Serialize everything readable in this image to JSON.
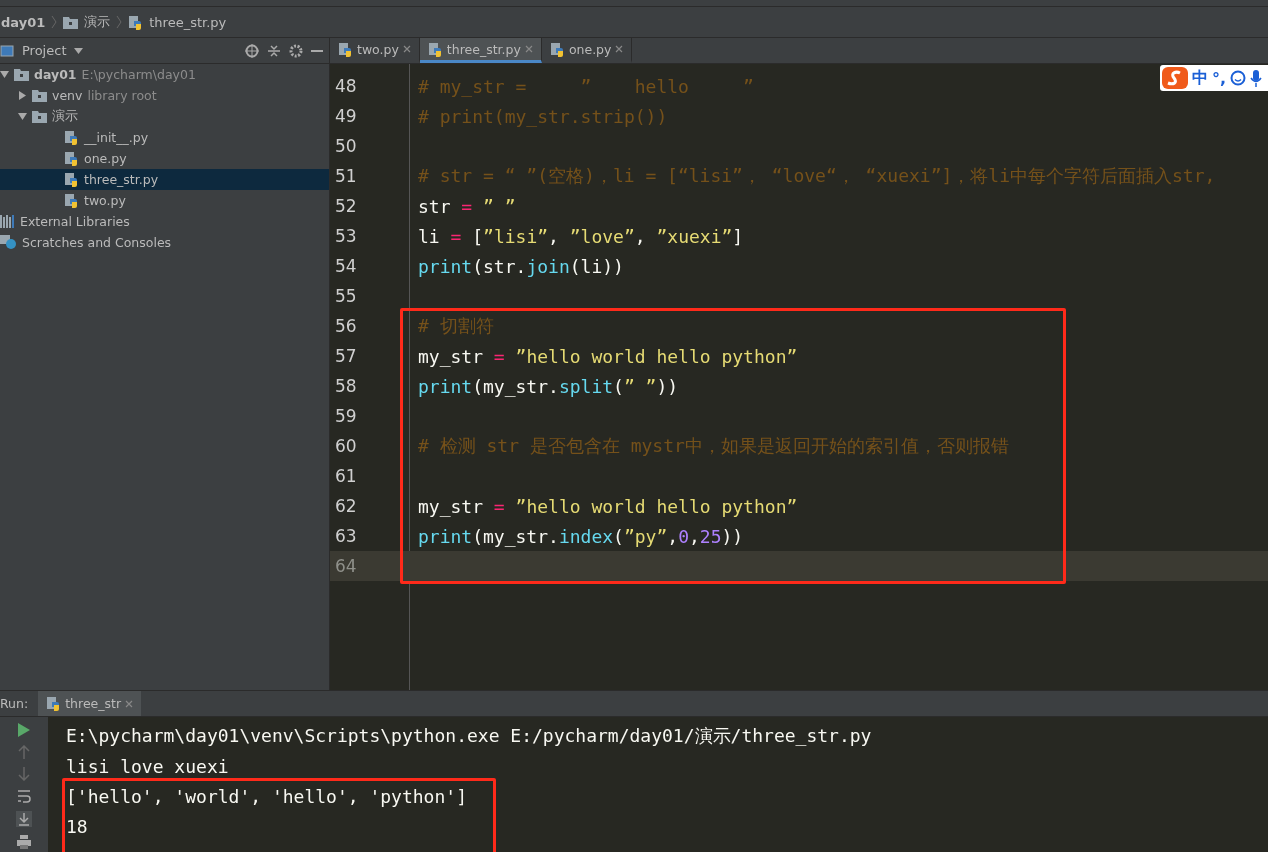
{
  "breadcrumbs": [
    "day01",
    "演示",
    "three_str.py"
  ],
  "project_panel": {
    "title": "Project",
    "tree": [
      {
        "label": "day01",
        "hint": "E:\\pycharm\\day01",
        "kind": "folder",
        "expanded": true,
        "selected": false,
        "children": [
          {
            "label": "venv",
            "hint": "library root",
            "kind": "folder",
            "expanded": false,
            "selected": false
          },
          {
            "label": "演示",
            "kind": "folder",
            "expanded": true,
            "selected": false,
            "children": [
              {
                "label": "__init__.py",
                "kind": "python",
                "selected": false
              },
              {
                "label": "one.py",
                "kind": "python",
                "selected": false
              },
              {
                "label": "three_str.py",
                "kind": "python",
                "selected": true
              },
              {
                "label": "two.py",
                "kind": "python",
                "selected": false
              }
            ]
          }
        ]
      },
      {
        "label": "External Libraries",
        "kind": "libraries",
        "selected": false
      },
      {
        "label": "Scratches and Consoles",
        "kind": "scratches",
        "selected": false
      }
    ]
  },
  "editor_tabs": [
    {
      "label": "two.py",
      "selected": false
    },
    {
      "label": "three_str.py",
      "selected": true
    },
    {
      "label": "one.py",
      "selected": false
    }
  ],
  "ime_toolbar": [
    "中",
    "°,"
  ],
  "code_lines": [
    {
      "number": "48",
      "current": false,
      "tokens": [
        {
          "kind": "comment",
          "text": "# my_str =     ”    hello     ”"
        }
      ]
    },
    {
      "number": "49",
      "current": false,
      "tokens": [
        {
          "kind": "comment",
          "text": "# print(my_str.strip())"
        }
      ]
    },
    {
      "number": "50",
      "current": false
    },
    {
      "number": "51",
      "current": false,
      "tokens": [
        {
          "kind": "comment",
          "text": "# str = “ ”(空格)，li = [“lisi”， “love“， “xuexi”]，将li中每个字符后面插入str,"
        }
      ]
    },
    {
      "number": "52",
      "current": false,
      "tokens": [
        {
          "kind": "plain",
          "text": "str "
        },
        {
          "kind": "operator",
          "text": "="
        },
        {
          "kind": "string",
          "text": " ” ”"
        }
      ]
    },
    {
      "number": "53",
      "current": false,
      "tokens": [
        {
          "kind": "plain",
          "text": "li "
        },
        {
          "kind": "operator",
          "text": "="
        },
        {
          "kind": "plain",
          "text": " ["
        },
        {
          "kind": "string",
          "text": "”lisi”"
        },
        {
          "kind": "plain",
          "text": ", "
        },
        {
          "kind": "string",
          "text": "”love”"
        },
        {
          "kind": "plain",
          "text": ", "
        },
        {
          "kind": "string",
          "text": "”xuexi”"
        },
        {
          "kind": "plain",
          "text": "]"
        }
      ]
    },
    {
      "number": "54",
      "current": false,
      "tokens": [
        {
          "kind": "function",
          "text": "print"
        },
        {
          "kind": "plain",
          "text": "(str."
        },
        {
          "kind": "function",
          "text": "join"
        },
        {
          "kind": "plain",
          "text": "(li))"
        }
      ]
    },
    {
      "number": "55",
      "current": false
    }
  ],
  "highlight_box": {
    "lines": [
      {
        "number": "56",
        "current": false,
        "tokens": [
          {
            "kind": "comment",
            "text": "# 切割符"
          }
        ]
      },
      {
        "number": "57",
        "current": false,
        "tokens": [
          {
            "kind": "plain",
            "text": "my_str "
          },
          {
            "kind": "operator",
            "text": "="
          },
          {
            "kind": "string",
            "text": " ”hello world hello python”"
          }
        ]
      },
      {
        "number": "58",
        "current": false,
        "tokens": [
          {
            "kind": "function",
            "text": "print"
          },
          {
            "kind": "plain",
            "text": "(my_str."
          },
          {
            "kind": "function",
            "text": "split"
          },
          {
            "kind": "plain",
            "text": "("
          },
          {
            "kind": "string",
            "text": "” ”"
          },
          {
            "kind": "plain",
            "text": "))"
          }
        ]
      },
      {
        "number": "59",
        "current": false
      },
      {
        "number": "60",
        "current": false,
        "tokens": [
          {
            "kind": "comment",
            "text": "# 检测 str 是否包含在 mystr中，如果是返回开始的索引值，否则报错"
          }
        ]
      },
      {
        "number": "61",
        "current": false
      },
      {
        "number": "62",
        "current": false,
        "tokens": [
          {
            "kind": "plain",
            "text": "my_str "
          },
          {
            "kind": "operator",
            "text": "="
          },
          {
            "kind": "string",
            "text": " ”hello world hello python”"
          }
        ]
      },
      {
        "number": "63",
        "current": false,
        "tokens": [
          {
            "kind": "function",
            "text": "print"
          },
          {
            "kind": "plain",
            "text": "(my_str."
          },
          {
            "kind": "function",
            "text": "index"
          },
          {
            "kind": "plain",
            "text": "("
          },
          {
            "kind": "string",
            "text": "”py”"
          },
          {
            "kind": "plain",
            "text": ","
          },
          {
            "kind": "number",
            "text": "0"
          },
          {
            "kind": "plain",
            "text": ","
          },
          {
            "kind": "number",
            "text": "25"
          },
          {
            "kind": "plain",
            "text": "))"
          }
        ]
      },
      {
        "number": "64",
        "current": true
      }
    ]
  },
  "run_panel": {
    "label": "Run:",
    "tab": "three_str",
    "output": [
      "E:\\pycharm\\day01\\venv\\Scripts\\python.exe E:/pycharm/day01/演示/three_str.py",
      "lisi love xuexi"
    ],
    "highlight_box": {
      "lines": [
        "['hello', 'world', 'hello', 'python']",
        "18"
      ]
    }
  }
}
